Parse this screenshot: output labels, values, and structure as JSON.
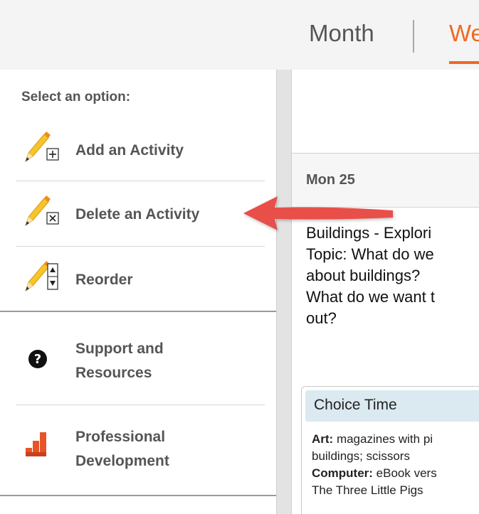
{
  "header": {
    "tabs": [
      {
        "label": "Month",
        "active": false
      },
      {
        "label": "We",
        "active": true
      }
    ],
    "accent_color": "#f26722"
  },
  "sidebar": {
    "prompt": "Select an option:",
    "items": [
      {
        "label": "Add an Activity",
        "icon": "pencil-add-icon"
      },
      {
        "label": "Delete an Activity",
        "icon": "pencil-delete-icon"
      },
      {
        "label": "Reorder",
        "icon": "pencil-reorder-icon"
      },
      {
        "label": "Support and Resources",
        "icon": "help-circle-icon"
      },
      {
        "label": "Professional Development",
        "icon": "steps-chart-icon"
      }
    ]
  },
  "day": {
    "label": "Mon 25",
    "lesson_lines": [
      "Buildings - Explori",
      "Topic: What do we",
      "about buildings?",
      "What do we want t",
      "out?"
    ],
    "card": {
      "title": "Choice Time",
      "entries": [
        {
          "label": "Art:",
          "text": " magazines with pi"
        },
        {
          "label": "",
          "text": "buildings; scissors"
        },
        {
          "label": "Computer:",
          "text": " eBook vers"
        },
        {
          "label": "",
          "text": "The Three Little Pigs"
        }
      ]
    }
  },
  "colors": {
    "pointer_arrow": "#e8504a",
    "card_header": "#dbe9f0"
  }
}
